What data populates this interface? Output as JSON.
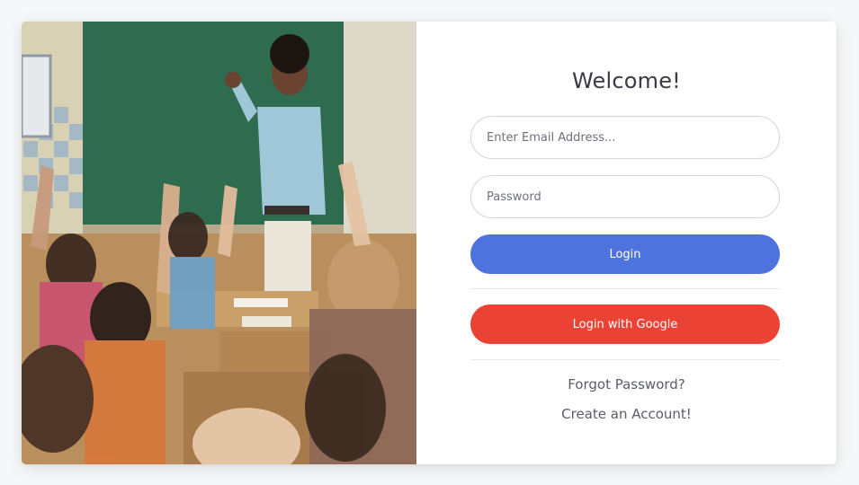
{
  "form": {
    "title": "Welcome!",
    "email_placeholder": "Enter Email Address...",
    "password_placeholder": "Password",
    "login_label": "Login",
    "google_login_label": "Login with Google",
    "forgot_password_label": "Forgot Password?",
    "create_account_label": "Create an Account!"
  },
  "colors": {
    "primary": "#4e73df",
    "google": "#ea4335",
    "chalkboard": "#2f6b4f",
    "text": "#3a3b45"
  }
}
